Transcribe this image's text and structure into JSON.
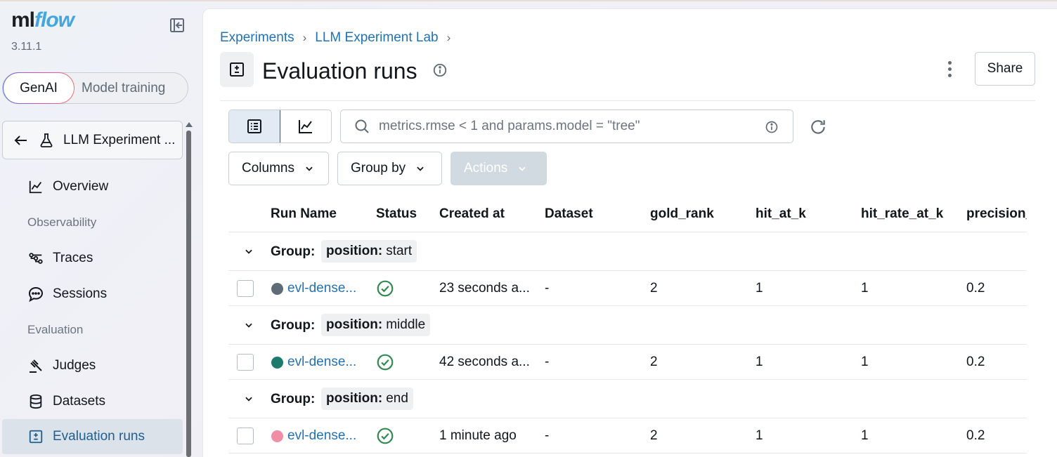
{
  "app": {
    "logo_ml": "ml",
    "logo_flow": "flow",
    "version": "3.11.1"
  },
  "mode_toggle": {
    "genai": "GenAI",
    "training": "Model training"
  },
  "experiment_selector": {
    "label": "LLM Experiment ..."
  },
  "nav": {
    "overview": "Overview",
    "section_observability": "Observability",
    "traces": "Traces",
    "sessions": "Sessions",
    "section_evaluation": "Evaluation",
    "judges": "Judges",
    "datasets": "Datasets",
    "evaluation_runs": "Evaluation runs"
  },
  "breadcrumb": {
    "experiments": "Experiments",
    "experiment": "LLM Experiment Lab"
  },
  "page": {
    "title": "Evaluation runs"
  },
  "header": {
    "share_label": "Share"
  },
  "search": {
    "placeholder": "metrics.rmse < 1 and params.model = \"tree\""
  },
  "toolbar": {
    "columns": "Columns",
    "group_by": "Group by",
    "actions": "Actions"
  },
  "table": {
    "columns": [
      "Run Name",
      "Status",
      "Created at",
      "Dataset",
      "gold_rank",
      "hit_at_k",
      "hit_rate_at_k",
      "precision_"
    ],
    "group_prefix": "Group:",
    "groups": [
      {
        "key": "position:",
        "value": "start",
        "rows": [
          {
            "run": "evl-dense...",
            "color": "#5f6b76",
            "created": "23 seconds a...",
            "dataset": "-",
            "gold_rank": "2",
            "hit_at_k": "1",
            "hit_rate_at_k": "1",
            "precision": "0.2"
          }
        ]
      },
      {
        "key": "position:",
        "value": "middle",
        "rows": [
          {
            "run": "evl-dense...",
            "color": "#1f7a6e",
            "created": "42 seconds a...",
            "dataset": "-",
            "gold_rank": "2",
            "hit_at_k": "1",
            "hit_rate_at_k": "1",
            "precision": "0.2"
          }
        ]
      },
      {
        "key": "position:",
        "value": "end",
        "rows": [
          {
            "run": "evl-dense...",
            "color": "#ee8fa5",
            "created": "1 minute ago",
            "dataset": "-",
            "gold_rank": "2",
            "hit_at_k": "1",
            "hit_rate_at_k": "1",
            "precision": "0.2"
          }
        ]
      }
    ]
  },
  "colors": {
    "accent": "#2272b4",
    "success": "#2f8a4f",
    "active_nav_bg": "#dbe2ea"
  },
  "icons": [
    "collapse-sidebar-icon",
    "arrow-left-icon",
    "flask-icon",
    "chart-line-icon",
    "traces-icon",
    "chat-bubble-icon",
    "gavel-icon",
    "database-icon",
    "plus-minus-box-icon",
    "info-icon",
    "kebab-icon",
    "list-view-icon",
    "chart-view-icon",
    "search-icon",
    "refresh-icon",
    "chevron-down-icon",
    "check-circle-icon"
  ]
}
